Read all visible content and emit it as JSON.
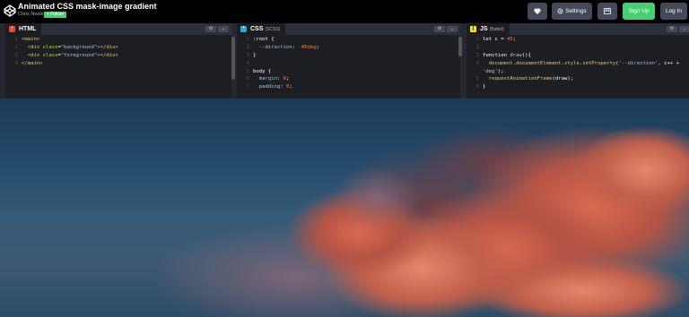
{
  "header": {
    "title": "Animated CSS mask-image gradient",
    "author": "Chris Neale",
    "follow_label": "+ Follow",
    "settings_label": "Settings",
    "signup_label": "Sign Up",
    "login_label": "Log In"
  },
  "editors": {
    "html": {
      "label": "HTML",
      "sub": "",
      "icon_color": "#e8453c",
      "lines": [
        {
          "n": "1",
          "parts": [
            [
              "tag",
              "<main>"
            ]
          ]
        },
        {
          "n": "2",
          "parts": [
            [
              "op",
              "  "
            ],
            [
              "tag",
              "<div "
            ],
            [
              "attr",
              "class"
            ],
            [
              "op",
              "="
            ],
            [
              "str",
              "\"background\""
            ],
            [
              "tag",
              "></div>"
            ]
          ]
        },
        {
          "n": "3",
          "parts": [
            [
              "op",
              "  "
            ],
            [
              "tag",
              "<div "
            ],
            [
              "attr",
              "class"
            ],
            [
              "op",
              "="
            ],
            [
              "str",
              "\"foreground\""
            ],
            [
              "tag",
              "></div>"
            ]
          ]
        },
        {
          "n": "4",
          "parts": [
            [
              "tag",
              "</main>"
            ]
          ]
        }
      ]
    },
    "css": {
      "label": "CSS",
      "sub": "(SCSS)",
      "icon_color": "#2fa8d8",
      "lines": [
        {
          "n": "1",
          "parts": [
            [
              "kw",
              ":root {"
            ]
          ]
        },
        {
          "n": "2",
          "parts": [
            [
              "op",
              "  "
            ],
            [
              "prop",
              "--direction"
            ],
            [
              "op",
              ": "
            ],
            [
              "num",
              "-45deg"
            ],
            [
              "op",
              ";"
            ]
          ]
        },
        {
          "n": "3",
          "parts": [
            [
              "kw",
              "}"
            ]
          ]
        },
        {
          "n": "4",
          "parts": [
            [
              "op",
              ""
            ]
          ]
        },
        {
          "n": "5",
          "parts": [
            [
              "kw",
              "body {"
            ]
          ]
        },
        {
          "n": "6",
          "parts": [
            [
              "op",
              "  "
            ],
            [
              "prop",
              "margin"
            ],
            [
              "op",
              ": "
            ],
            [
              "num",
              "0"
            ],
            [
              "op",
              ";"
            ]
          ]
        },
        {
          "n": "7",
          "parts": [
            [
              "op",
              "  "
            ],
            [
              "prop",
              "padding"
            ],
            [
              "op",
              ": "
            ],
            [
              "num",
              "0"
            ],
            [
              "op",
              ";"
            ]
          ]
        }
      ]
    },
    "js": {
      "label": "JS",
      "sub": "(Babel)",
      "icon_color": "#f7df1e",
      "lines": [
        {
          "n": "1",
          "parts": [
            [
              "kw",
              "let c = "
            ],
            [
              "num",
              "45"
            ],
            [
              "op",
              ";"
            ]
          ]
        },
        {
          "n": "2",
          "parts": [
            [
              "op",
              ""
            ]
          ]
        },
        {
          "n": "3",
          "parts": [
            [
              "kw",
              "function "
            ],
            [
              "fn",
              "draw"
            ],
            [
              "op",
              "(){"
            ]
          ]
        },
        {
          "n": "4",
          "parts": [
            [
              "op",
              "  "
            ],
            [
              "fn",
              "document"
            ],
            [
              "op",
              "."
            ],
            [
              "fn",
              "documentElement"
            ],
            [
              "op",
              "."
            ],
            [
              "fn",
              "style"
            ],
            [
              "op",
              "."
            ],
            [
              "fn",
              "setProperty"
            ],
            [
              "op",
              "("
            ],
            [
              "str",
              "'--direction'"
            ],
            [
              "op",
              ", c++ +"
            ]
          ]
        },
        {
          "n": "",
          "parts": [
            [
              "str",
              "'deg'"
            ],
            [
              "op",
              ");"
            ]
          ]
        },
        {
          "n": "5",
          "parts": [
            [
              "op",
              "  "
            ],
            [
              "fn",
              "requestAnimationFrame"
            ],
            [
              "op",
              "(draw);"
            ]
          ]
        },
        {
          "n": "6",
          "parts": [
            [
              "kw",
              "}"
            ]
          ]
        }
      ]
    }
  }
}
